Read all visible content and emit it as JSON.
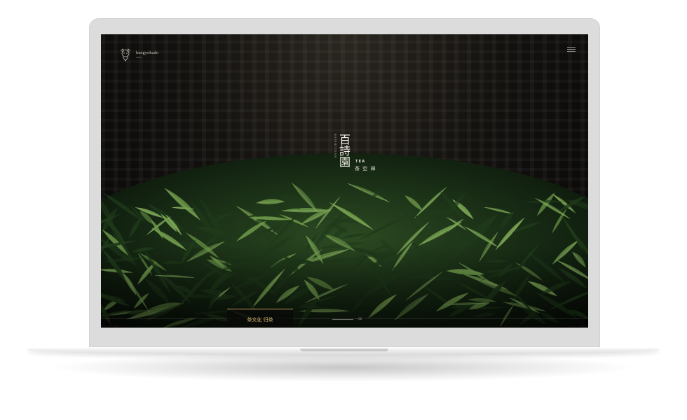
{
  "brand": {
    "name": "kungyokudo",
    "subtitle": "Amuse"
  },
  "hero": {
    "title_vertical": "百詩園",
    "subtitle_vertical": "BAISHIYUAN",
    "tea_label_en": "TEA",
    "tea_label_cn": "茶 空 禅"
  },
  "bottom_nav": {
    "active_label": "茶文化 归茶",
    "progress_label": "-- 02"
  },
  "colors": {
    "accent": "#d7b873",
    "lid": "#dcdcdc",
    "leaf_dark": "#1f3a1a",
    "leaf_light": "#6f9a4a"
  }
}
